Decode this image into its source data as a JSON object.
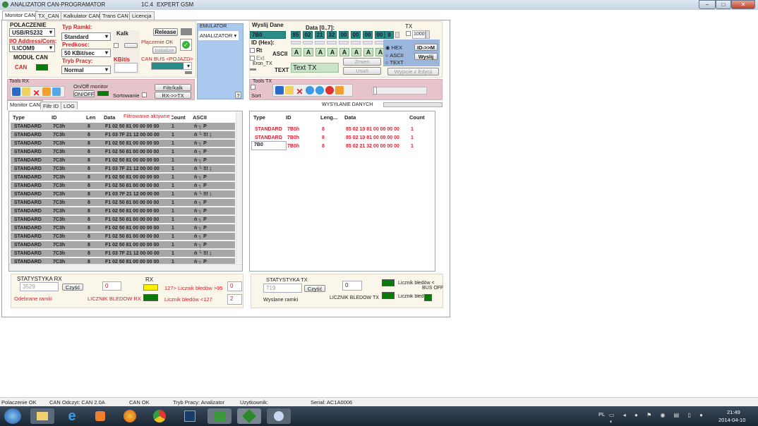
{
  "window": {
    "title": "ANALIZATOR CAN-PROGRAMATOR",
    "version": "1C.4",
    "brand": "EXPERT GSM",
    "controls": [
      "–",
      "□",
      "✕"
    ]
  },
  "tabs": [
    "Monitor CAN",
    "TX_CAN",
    "Kalkulator CAN",
    "Trans CAN",
    "Licencja"
  ],
  "config": {
    "polaczenie_label": "POLACZENIE",
    "polaczenie_value": "USB/RS232",
    "io_label": "I/O Address/Com:",
    "io_value": "\\\\.\\COM9",
    "modul_label": "MODUŁ CAN",
    "can_label": "CAN",
    "typ_ramki_label": "Typ Ramki:",
    "typ_ramki_value": "Standard",
    "predkosc_label": "Predkosc:",
    "predkosc_value": "50 KBit/sec",
    "tryb_label": "Tryb Pracy:",
    "tryb_value": "Normal",
    "kalk_label": "Kalk",
    "kbits_label": "KBit/s",
    "release_button": "Release",
    "polaczenie_ok": "Płączenie OK",
    "initialize_button": "Initialize",
    "can_bus_label": "CAN BUS <POJAZD>"
  },
  "emulator": {
    "label": "EMULATOR",
    "value": "ANALIZATOR",
    "help": "?"
  },
  "tools_rx": {
    "label": "Tools RX",
    "onoff_group": "On/Off monitor",
    "onoff_button": "ON/OFF",
    "sort_label": "Sortowanie",
    "filtr_button": "Filtr/kalk",
    "rxtx_button": "RX->>TX"
  },
  "send": {
    "title": "Wyslij Dane",
    "data_label": "Data [0..7]:",
    "tx_label": "TX",
    "id_label": "ID (Hex):",
    "id_value": "7B0",
    "bytes": [
      "85",
      "02",
      "21",
      "32",
      "00",
      "00",
      "00",
      "00"
    ],
    "dlc": "8",
    "interval": "1000",
    "rt_label": "Rt",
    "ext_label": "Ext",
    "eron_label": "Eron_TX",
    "ascii_label": "ASCII",
    "ascii": [
      "A",
      "A",
      "A",
      "A",
      "A",
      "A",
      "A",
      "A"
    ],
    "text_label": "TEXT",
    "text_value": "Text TX",
    "zmien_button": "Zmień",
    "usun_button": "Usuń",
    "radio_hex": "HEX",
    "radio_ascii": "ASCII",
    "radio_text": "TEXT",
    "idm_button": "ID->>M",
    "wyslij_button": "Wyslij",
    "wyjscie_button": "Wyjscie z Edycji"
  },
  "tools_tx": {
    "label": "Tools TX",
    "sort_label": "Sort",
    "sending_label": "WYSYŁANIE DANYCH"
  },
  "subtabs": [
    "Monitor CAN",
    "Filtr ID",
    "LOG"
  ],
  "rx_table": {
    "filter_notice": "Filtrowanie aktywne",
    "columns": [
      "Type",
      "ID",
      "Len",
      "Data",
      "Count",
      "ASCII"
    ],
    "rows": [
      [
        "STANDARD",
        "7C3h",
        "8",
        "F1 02 50 81 00 00 00 00",
        "1",
        "ń ┐ P"
      ],
      [
        "STANDARD",
        "7C3h",
        "8",
        "F1 03 7F 21 12 00 00 00",
        "1",
        "ń └ ‼! ↨"
      ],
      [
        "STANDARD",
        "7C3h",
        "8",
        "F1 02 50 81 00 00 00 00",
        "1",
        "ń ┐ P"
      ],
      [
        "STANDARD",
        "7C3h",
        "8",
        "F1 02 50 81 00 00 00 00",
        "1",
        "ń ┐ P"
      ],
      [
        "STANDARD",
        "7C3h",
        "8",
        "F1 02 50 81 00 00 00 00",
        "1",
        "ń ┐ P"
      ],
      [
        "STANDARD",
        "7C3h",
        "8",
        "F1 03 7F 21 12 00 00 00",
        "1",
        "ń └ ‼! ↨"
      ],
      [
        "STANDARD",
        "7C3h",
        "8",
        "F1 02 50 81 00 00 00 00",
        "1",
        "ń ┐ P"
      ],
      [
        "STANDARD",
        "7C3h",
        "8",
        "F1 02 50 81 00 00 00 00",
        "1",
        "ń ┐ P"
      ],
      [
        "STANDARD",
        "7C3h",
        "8",
        "F1 03 7F 21 12 00 00 00",
        "1",
        "ń └ ‼! ↨"
      ],
      [
        "STANDARD",
        "7C3h",
        "8",
        "F1 02 50 81 00 00 00 00",
        "1",
        "ń ┐ P"
      ],
      [
        "STANDARD",
        "7C3h",
        "8",
        "F1 02 50 81 00 00 00 00",
        "1",
        "ń ┐ P"
      ],
      [
        "STANDARD",
        "7C3h",
        "8",
        "F1 02 50 81 00 00 00 00",
        "1",
        "ń ┐ P"
      ],
      [
        "STANDARD",
        "7C3h",
        "8",
        "F1 02 50 81 00 00 00 00",
        "1",
        "ń ┐ P"
      ],
      [
        "STANDARD",
        "7C3h",
        "8",
        "F1 02 50 81 00 00 00 00",
        "1",
        "ń ┐ P"
      ],
      [
        "STANDARD",
        "7C3h",
        "8",
        "F1 02 50 81 00 00 00 00",
        "1",
        "ń ┐ P"
      ],
      [
        "STANDARD",
        "7C3h",
        "8",
        "F1 03 7F 21 12 00 00 00",
        "1",
        "ń └ ‼! ↨"
      ],
      [
        "STANDARD",
        "7C3h",
        "8",
        "F1 02 50 81 00 00 00 00",
        "1",
        "ń ┐ P"
      ]
    ]
  },
  "tx_table": {
    "columns": [
      "Type",
      "ID",
      "Leng...",
      "Data",
      "Count"
    ],
    "edit_value": "7B0",
    "rows": [
      [
        "STANDARD",
        "7B0h",
        "8",
        "85 02 10 81 00 00 00 00",
        "1"
      ],
      [
        "STANDARD",
        "7B0h",
        "8",
        "85 02 10 81 00 00 00 00",
        "1"
      ],
      [
        "",
        "7B0h",
        "8",
        "85 02 21 32 00 00 00 00",
        "1"
      ]
    ]
  },
  "stats_rx": {
    "title": "STATYSTYKA RX",
    "count": "3529",
    "clear_button": "Czyść",
    "errors": "0",
    "received_label": "Odebrane ramki",
    "error_label": "LICZNIK BLEDOW RX",
    "rx_label": "RX",
    "warn_label": "127> Licznik błedów >95",
    "warn_value": "0",
    "ok_label": "Licznik błedów <127",
    "ok_value": "2"
  },
  "stats_tx": {
    "title": "STATYSTYKA TX",
    "count": "719",
    "clear_button": "Czyść",
    "errors": "0",
    "sent_label": "Wyslane ramki",
    "error_label": "LICZNIK BLEDOW TX",
    "busoff_label": "Licznik błedów <",
    "busoff_label2": "BUS OFF",
    "ok_label": "Licznik błedów"
  },
  "statusbar": [
    "Polaczenie OK",
    "CAN Odczyt: CAN 2.0A",
    "CAN OK",
    "Tryb Pracy: Analizator",
    "Uzytkownik:",
    "Serial: AC1A0006"
  ],
  "taskbar": {
    "lang": "PL",
    "time": "21:49",
    "date": "2014-04-10"
  }
}
